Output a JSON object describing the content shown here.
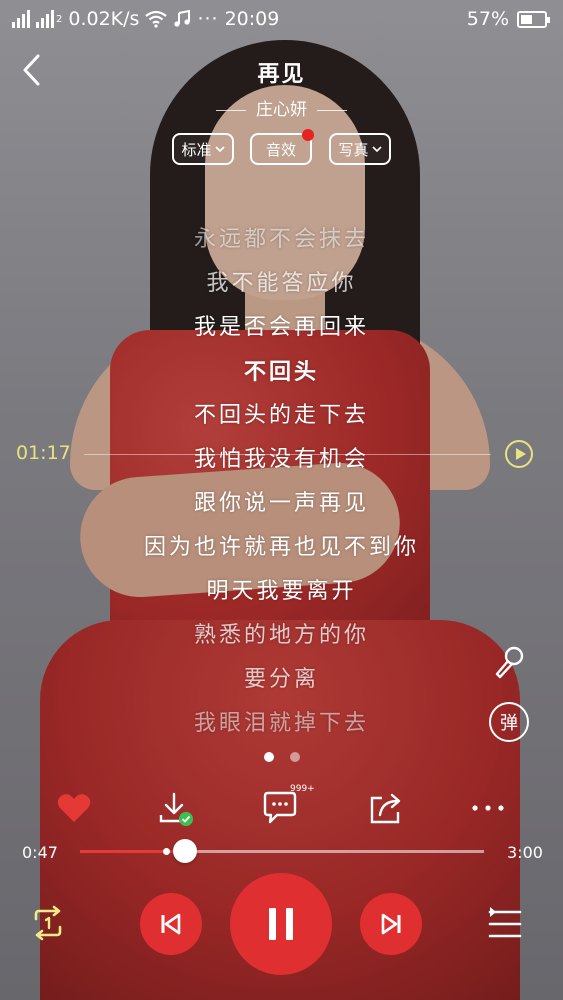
{
  "status_bar": {
    "network_speed": "0.02K/s",
    "time": "20:09",
    "battery": "57%",
    "battery_level": 0.57,
    "sim2_label": "2"
  },
  "header": {
    "title": "再见",
    "artist": "庄心妍"
  },
  "pills": {
    "quality": "标准",
    "effects": "音效",
    "mode": "写真"
  },
  "lyrics": [
    "永远都不会抹去",
    "我不能答应你",
    "我是否会再回来",
    "不回头",
    "不回头的走下去",
    "我怕我没有机会",
    "跟你说一声再见",
    "因为也许就再也见不到你",
    "明天我要离开",
    "熟悉的地方的你",
    "要分离",
    "我眼泪就掉下去"
  ],
  "lyric_seek": {
    "time": "01:17"
  },
  "side": {
    "danmaku_label": "弹"
  },
  "pager": {
    "count": 2,
    "active": 0
  },
  "actions": {
    "comment_count": "999+"
  },
  "progress": {
    "elapsed": "0:47",
    "total": "3:00",
    "fraction": 0.261
  },
  "colors": {
    "accent": "#e02f30",
    "lyric_time": "#e8e37f",
    "like": "#e53935",
    "download_ok": "#3dbe53"
  },
  "icons": [
    "back-icon",
    "wifi-icon",
    "music-note-icon",
    "more-icon",
    "mic-icon",
    "heart-icon",
    "download-icon",
    "comment-icon",
    "share-icon",
    "repeat-one-icon",
    "previous-icon",
    "pause-icon",
    "next-icon",
    "playlist-icon"
  ]
}
